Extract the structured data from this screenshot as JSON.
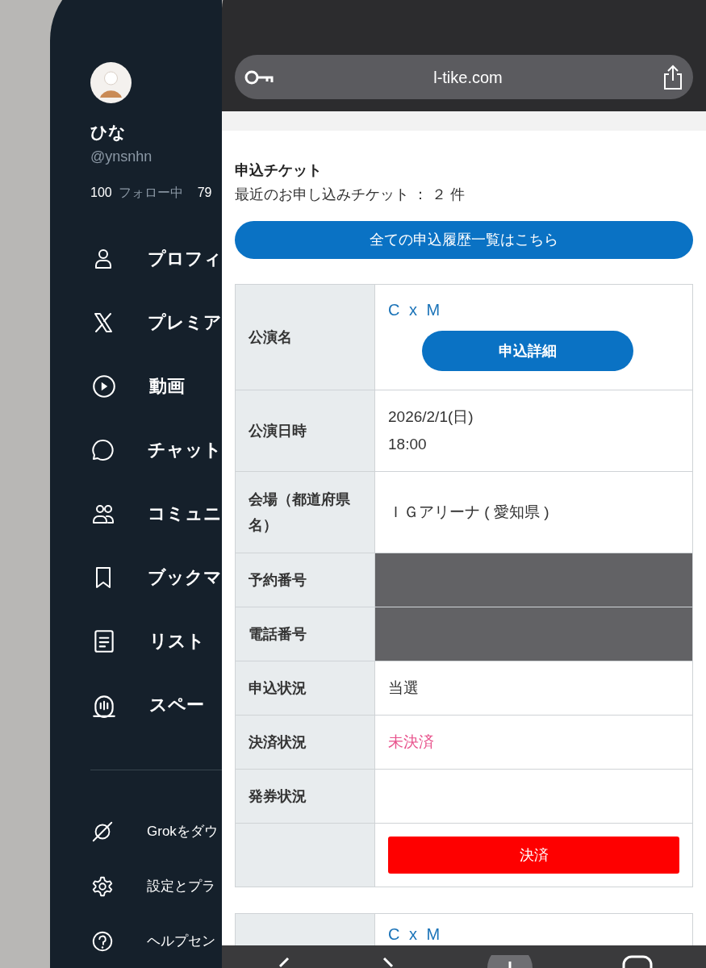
{
  "sidebar": {
    "profile": {
      "name": "ひな",
      "handle": "@ynsnhn",
      "following_count": "100",
      "following_label": "フォロー中",
      "followers_count": "79"
    },
    "menu": [
      {
        "kind": "person",
        "label": "プロフィ"
      },
      {
        "kind": "x",
        "label": "プレミア"
      },
      {
        "kind": "play",
        "label": "動画"
      },
      {
        "kind": "chat",
        "label": "チャット"
      },
      {
        "kind": "people",
        "label": "コミュニ"
      },
      {
        "kind": "bookmark",
        "label": "ブックマ"
      },
      {
        "kind": "list",
        "label": "リスト"
      },
      {
        "kind": "mic",
        "label": "スペー"
      }
    ],
    "footer": [
      {
        "kind": "slash",
        "label": "Grokをダウ"
      },
      {
        "kind": "gear",
        "label": "設定とプラ"
      },
      {
        "kind": "help",
        "label": "ヘルプセン"
      }
    ]
  },
  "browser": {
    "url": "l-tike.com",
    "section_title": "申込チケット",
    "summary": "最近のお申し込みチケット ： ２ 件",
    "history_button": "全ての申込履歴一覧はこちら",
    "tickets": [
      {
        "rows": [
          {
            "kind": "title",
            "label": "公演名",
            "value": "C x M",
            "button": "申込詳細"
          },
          {
            "kind": "text",
            "label": "公演日時",
            "lines": [
              "2026/2/1(日)",
              "18:00"
            ]
          },
          {
            "kind": "text",
            "label": "会場（都道府県名）",
            "lines": [
              "ＩＧアリーナ ( 愛知県 )"
            ]
          },
          {
            "kind": "redacted",
            "label": "予約番号"
          },
          {
            "kind": "redacted",
            "label": "電話番号"
          },
          {
            "kind": "text",
            "label": "申込状況",
            "lines": [
              "当選"
            ]
          },
          {
            "kind": "alert",
            "label": "決済状況",
            "lines": [
              "未決済"
            ]
          },
          {
            "kind": "text",
            "label": "発券状況"
          },
          {
            "kind": "pay",
            "button": "決済"
          }
        ]
      },
      {
        "rows": [
          {
            "kind": "title",
            "value": "C x M"
          }
        ]
      }
    ]
  }
}
